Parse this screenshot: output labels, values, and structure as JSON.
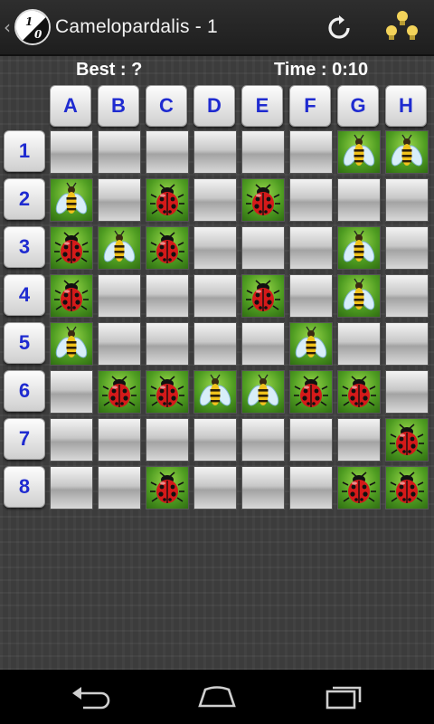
{
  "header": {
    "title": "Camelopardalis - 1",
    "logo_digits": [
      "1",
      "0"
    ],
    "refresh_icon": "refresh-icon",
    "hint_icon": "lightbulbs-icon"
  },
  "stats": {
    "best": "Best : ?",
    "time": "Time : 0:10"
  },
  "columns": [
    "A",
    "B",
    "C",
    "D",
    "E",
    "F",
    "G",
    "H"
  ],
  "rows": [
    "1",
    "2",
    "3",
    "4",
    "5",
    "6",
    "7",
    "8"
  ],
  "grid": [
    [
      "empty",
      "empty",
      "empty",
      "empty",
      "empty",
      "empty",
      "bee",
      "bee"
    ],
    [
      "bee",
      "empty",
      "ladybug",
      "empty",
      "ladybug",
      "empty",
      "empty",
      "empty"
    ],
    [
      "ladybug",
      "bee",
      "ladybug",
      "empty",
      "empty",
      "empty",
      "bee",
      "empty"
    ],
    [
      "ladybug",
      "empty",
      "empty",
      "empty",
      "ladybug",
      "empty",
      "bee",
      "empty"
    ],
    [
      "bee",
      "empty",
      "empty",
      "empty",
      "empty",
      "bee",
      "empty",
      "empty"
    ],
    [
      "empty",
      "ladybug",
      "ladybug",
      "bee",
      "bee",
      "ladybug",
      "ladybug",
      "empty"
    ],
    [
      "empty",
      "empty",
      "empty",
      "empty",
      "empty",
      "empty",
      "empty",
      "ladybug"
    ],
    [
      "empty",
      "empty",
      "ladybug",
      "empty",
      "empty",
      "empty",
      "ladybug",
      "ladybug"
    ]
  ],
  "nav": {
    "back_icon": "back-icon",
    "home_icon": "home-icon",
    "recents_icon": "recent-apps-icon"
  },
  "colors": {
    "header_text": "#1f2bd0",
    "cell_green": "#4f9d22",
    "ladybug_red": "#d41a1a"
  }
}
